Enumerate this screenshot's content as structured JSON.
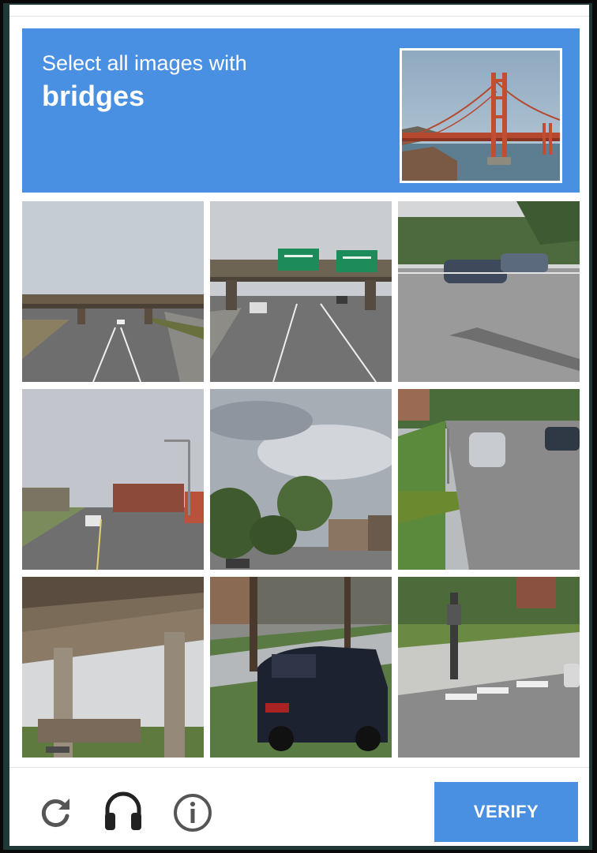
{
  "header": {
    "instruction": "Select all images with",
    "target": "bridges",
    "sample_image": "golden-gate-bridge-sample"
  },
  "grid": {
    "tiles": [
      {
        "scene": "highway-overpass"
      },
      {
        "scene": "highway-overpass-with-signs"
      },
      {
        "scene": "street-parked-cars"
      },
      {
        "scene": "city-street-streetlight"
      },
      {
        "scene": "trees-cloudy-sky"
      },
      {
        "scene": "residential-street-car"
      },
      {
        "scene": "under-bridge-pillars"
      },
      {
        "scene": "suv-on-street"
      },
      {
        "scene": "crosswalk-sidewalk"
      }
    ]
  },
  "footer": {
    "reload_icon": "reload-icon",
    "audio_icon": "headphones-icon",
    "info_icon": "info-icon",
    "verify_label": "VERIFY"
  },
  "colors": {
    "accent": "#4a90e2",
    "background": "#ffffff",
    "icon": "#555555"
  }
}
